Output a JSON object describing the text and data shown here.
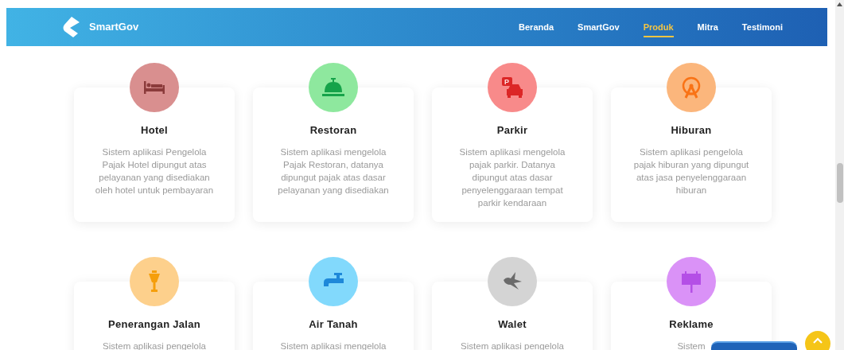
{
  "navbar": {
    "brand": "SmartGov",
    "links": [
      {
        "label": "Beranda",
        "selected": false
      },
      {
        "label": "SmartGov",
        "selected": false
      },
      {
        "label": "Produk",
        "selected": true
      },
      {
        "label": "Mitra",
        "selected": false
      },
      {
        "label": "Testimoni",
        "selected": false
      }
    ]
  },
  "products": [
    {
      "kind": "bed",
      "color": "#d98f8f",
      "title": "Hotel",
      "description": "Sistem aplikasi Pengelola Pajak Hotel dipungut atas pelayanan yang disediakan oleh hotel untuk pembayaran"
    },
    {
      "kind": "bell",
      "color": "#8ee89e",
      "title": "Restoran",
      "description": "Sistem aplikasi mengelola Pajak Restoran, datanya dipungut pajak atas dasar pelayanan yang disediakan"
    },
    {
      "kind": "parking",
      "sign": "P",
      "color": "#f88a8a",
      "title": "Parkir",
      "description": "Sistem aplikasi mengelola pajak parkir. Datanya dipungut atas dasar penyelenggaraan tempat parkir kendaraan"
    },
    {
      "kind": "ferris",
      "color": "#fbb67c",
      "title": "Hiburan",
      "description": "Sistem aplikasi pengelola pajak hiburan yang dipungut atas jasa penyelenggaraan hiburan"
    },
    {
      "kind": "lamp",
      "color": "#fdd08c",
      "title": "Penerangan Jalan",
      "description": "Sistem aplikasi pengelola"
    },
    {
      "kind": "faucet",
      "color": "#82d9fc",
      "title": "Air Tanah",
      "description": "Sistem aplikasi mengelola"
    },
    {
      "kind": "bird",
      "color": "#d4d4d4",
      "title": "Walet",
      "description": "Sistem aplikasi pengelola"
    },
    {
      "kind": "billboard",
      "color": "#da92f7",
      "title": "Reklame",
      "description": "Sistem"
    }
  ]
}
